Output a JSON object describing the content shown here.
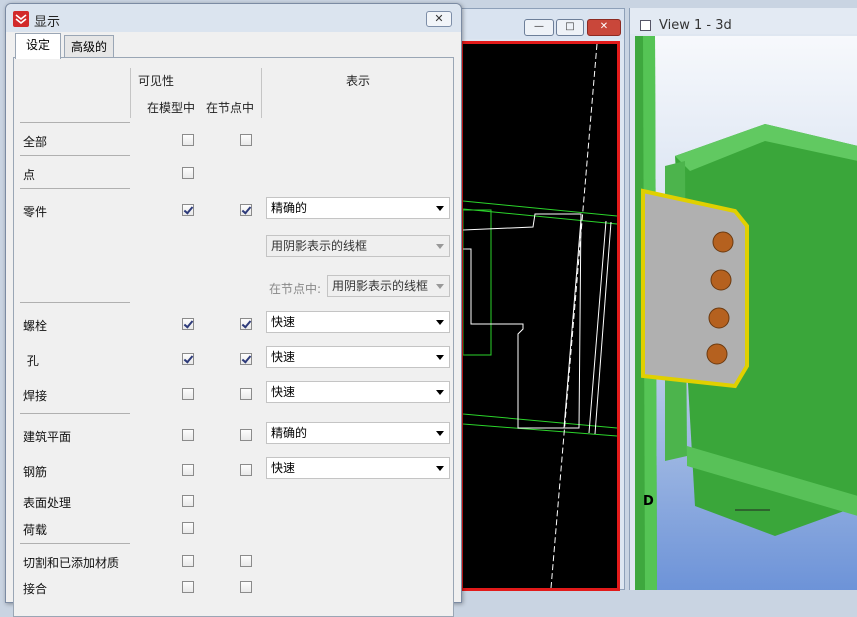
{
  "dialog": {
    "title": "显示",
    "close_glyph": "✕",
    "tabs": [
      {
        "label": "设定"
      },
      {
        "label": "高级的"
      }
    ]
  },
  "headers": {
    "visibility": "可见性",
    "in_model": "在模型中",
    "in_node": "在节点中",
    "representation": "表示"
  },
  "rows": [
    {
      "label": "全部",
      "model": false,
      "node": false
    },
    {
      "label": "点",
      "model": false
    },
    {
      "label": "零件",
      "model": true,
      "node": true,
      "display": "精确的",
      "display2": "用阴影表示的线框",
      "node_label": "在节点中:",
      "node_display": "用阴影表示的线框"
    },
    {
      "label": "螺栓",
      "model": true,
      "node": true,
      "display": "快速"
    },
    {
      "label": " 孔",
      "model": true,
      "node": true,
      "display": "快速"
    },
    {
      "label": "焊接",
      "model": false,
      "node": false,
      "display": "快速"
    },
    {
      "label": "建筑平面",
      "model": false,
      "node": false,
      "display": "精确的"
    },
    {
      "label": "钢筋",
      "model": false,
      "node": false,
      "display": "快速"
    },
    {
      "label": "表面处理",
      "model": false
    },
    {
      "label": "荷载",
      "model": false
    },
    {
      "label": "切割和已添加材质",
      "model": false,
      "node": false
    },
    {
      "label": "接合",
      "model": false,
      "node": false
    }
  ],
  "view3d": {
    "title": "View 1 - 3d",
    "axis_label": "D"
  },
  "view2d": {
    "minimize_glyph": "—",
    "maximize_glyph": "□",
    "close_glyph": "✕"
  }
}
